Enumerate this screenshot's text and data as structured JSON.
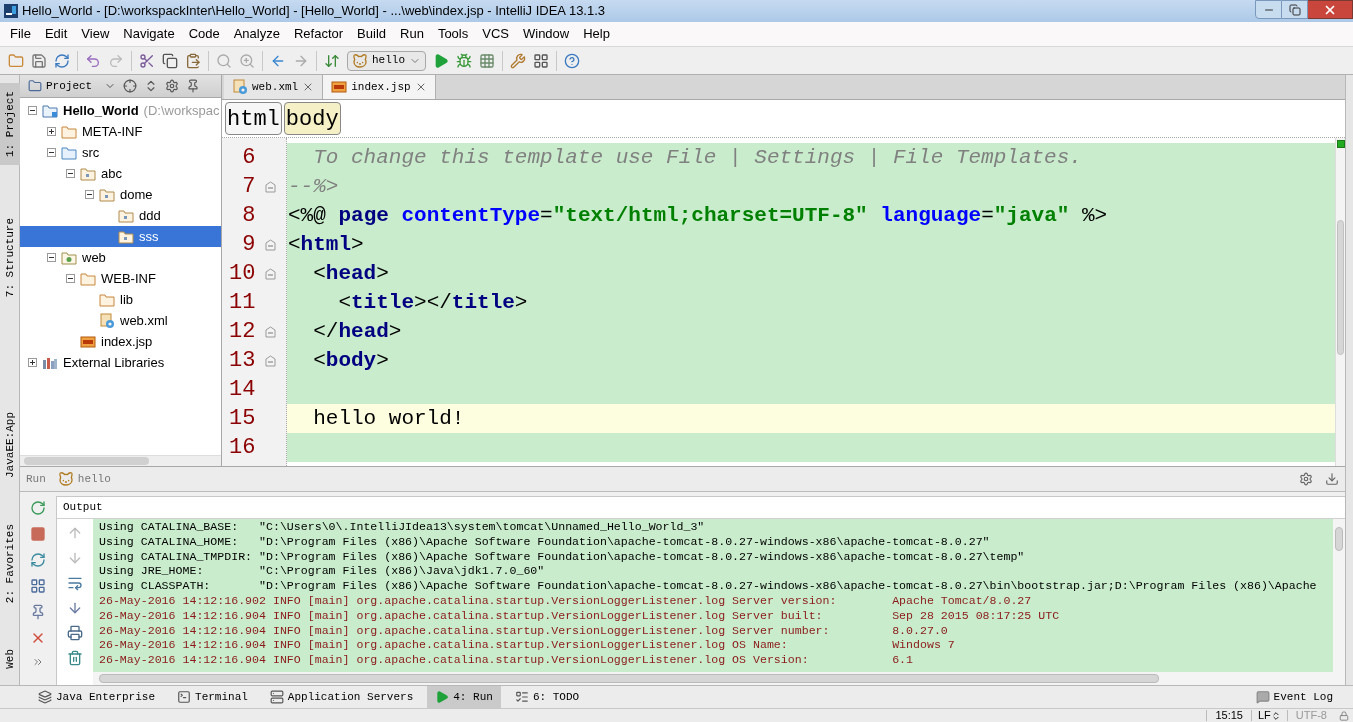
{
  "window": {
    "title": "Hello_World - [D:\\workspackInter\\Hello_World] - [Hello_World] - ...\\web\\index.jsp - IntelliJ IDEA 13.1.3"
  },
  "menu": [
    "File",
    "Edit",
    "View",
    "Navigate",
    "Code",
    "Analyze",
    "Refactor",
    "Build",
    "Run",
    "Tools",
    "VCS",
    "Window",
    "Help"
  ],
  "toolbar": {
    "run_config": "hello"
  },
  "left_stripe": {
    "top": [
      {
        "label": "1: Project",
        "selected": true
      },
      {
        "label": "7: Structure",
        "selected": false
      }
    ],
    "bottom": [
      {
        "label": "JavaEE:App",
        "selected": false
      },
      {
        "label": "2: Favorites",
        "selected": false
      },
      {
        "label": "Web",
        "selected": false
      }
    ]
  },
  "project_panel": {
    "title": "Project",
    "tree": [
      {
        "label": "Hello_World",
        "hint": "(D:\\workspac",
        "kind": "module",
        "expanded": true,
        "selected": false,
        "children": [
          {
            "label": "META-INF",
            "kind": "folder",
            "expanded": false,
            "selected": false
          },
          {
            "label": "src",
            "kind": "source",
            "expanded": true,
            "selected": false,
            "children": [
              {
                "label": "abc",
                "kind": "package",
                "expanded": true,
                "selected": false,
                "children": [
                  {
                    "label": "dome",
                    "kind": "package",
                    "expanded": true,
                    "selected": false,
                    "children": [
                      {
                        "label": "ddd",
                        "kind": "package",
                        "selected": false
                      },
                      {
                        "label": "sss",
                        "kind": "package",
                        "selected": true
                      }
                    ]
                  }
                ]
              }
            ]
          },
          {
            "label": "web",
            "kind": "webfolder",
            "expanded": true,
            "selected": false,
            "children": [
              {
                "label": "WEB-INF",
                "kind": "folder",
                "expanded": true,
                "selected": false,
                "children": [
                  {
                    "label": "lib",
                    "kind": "folder",
                    "selected": false
                  },
                  {
                    "label": "web.xml",
                    "kind": "xml",
                    "selected": false
                  }
                ]
              },
              {
                "label": "index.jsp",
                "kind": "jsp",
                "selected": false
              }
            ]
          }
        ]
      },
      {
        "label": "External Libraries",
        "kind": "library",
        "expanded": false,
        "selected": false
      }
    ]
  },
  "editor": {
    "tabs": [
      {
        "label": "web.xml",
        "kind": "xml",
        "selected": false
      },
      {
        "label": "index.jsp",
        "kind": "jsp",
        "selected": true
      }
    ],
    "breadcrumbs": [
      {
        "label": "html",
        "selected": false
      },
      {
        "label": "body",
        "selected": true
      }
    ],
    "lines": [
      {
        "number": "6",
        "fold": false,
        "current": false,
        "segments": [
          {
            "kind": "comment",
            "text": "  To change this template use File | Settings | File Templates."
          }
        ]
      },
      {
        "number": "7",
        "fold": true,
        "current": false,
        "segments": [
          {
            "kind": "comment",
            "text": "--%>"
          }
        ]
      },
      {
        "number": "8",
        "fold": false,
        "current": false,
        "segments": [
          {
            "kind": "plain",
            "text": "<%@ "
          },
          {
            "kind": "keyword",
            "text": "page "
          },
          {
            "kind": "attr",
            "text": "contentType"
          },
          {
            "kind": "plain",
            "text": "="
          },
          {
            "kind": "string",
            "text": "\"text/html;charset=UTF-8\""
          },
          {
            "kind": "attr",
            "text": " language"
          },
          {
            "kind": "plain",
            "text": "="
          },
          {
            "kind": "string",
            "text": "\"java\""
          },
          {
            "kind": "plain",
            "text": " %>"
          }
        ]
      },
      {
        "number": "9",
        "fold": true,
        "current": false,
        "segments": [
          {
            "kind": "plain",
            "text": "<"
          },
          {
            "kind": "tag",
            "text": "html"
          },
          {
            "kind": "plain",
            "text": ">"
          }
        ]
      },
      {
        "number": "10",
        "fold": true,
        "current": false,
        "segments": [
          {
            "kind": "plain",
            "text": "  <"
          },
          {
            "kind": "tag",
            "text": "head"
          },
          {
            "kind": "plain",
            "text": ">"
          }
        ]
      },
      {
        "number": "11",
        "fold": false,
        "current": false,
        "segments": [
          {
            "kind": "plain",
            "text": "    <"
          },
          {
            "kind": "tag",
            "text": "title"
          },
          {
            "kind": "plain",
            "text": "></"
          },
          {
            "kind": "tag",
            "text": "title"
          },
          {
            "kind": "plain",
            "text": ">"
          }
        ]
      },
      {
        "number": "12",
        "fold": true,
        "current": false,
        "segments": [
          {
            "kind": "plain",
            "text": "  </"
          },
          {
            "kind": "tag",
            "text": "head"
          },
          {
            "kind": "plain",
            "text": ">"
          }
        ]
      },
      {
        "number": "13",
        "fold": true,
        "current": false,
        "segments": [
          {
            "kind": "plain",
            "text": "  <"
          },
          {
            "kind": "tag",
            "text": "body"
          },
          {
            "kind": "plain",
            "text": ">"
          }
        ]
      },
      {
        "number": "14",
        "fold": false,
        "current": false
      },
      {
        "number": "15",
        "fold": false,
        "current": true,
        "segments": [
          {
            "kind": "plain",
            "text": "  hello world!"
          }
        ]
      },
      {
        "number": "16",
        "fold": false,
        "current": false
      }
    ]
  },
  "run_panel": {
    "title": "Run",
    "config": "hello",
    "output_tab": "Output",
    "console": [
      {
        "kind": "info",
        "text": "Using CATALINA_BASE:   \"C:\\Users\\0\\.IntelliJIdea13\\system\\tomcat\\Unnamed_Hello_World_3\""
      },
      {
        "kind": "info",
        "text": "Using CATALINA_HOME:   \"D:\\Program Files (x86)\\Apache Software Foundation\\apache-tomcat-8.0.27-windows-x86\\apache-tomcat-8.0.27\""
      },
      {
        "kind": "info",
        "text": "Using CATALINA_TMPDIR: \"D:\\Program Files (x86)\\Apache Software Foundation\\apache-tomcat-8.0.27-windows-x86\\apache-tomcat-8.0.27\\temp\""
      },
      {
        "kind": "info",
        "text": "Using JRE_HOME:        \"C:\\Program Files (x86)\\Java\\jdk1.7.0_60\""
      },
      {
        "kind": "info",
        "text": "Using CLASSPATH:       \"D:\\Program Files (x86)\\Apache Software Foundation\\apache-tomcat-8.0.27-windows-x86\\apache-tomcat-8.0.27\\bin\\bootstrap.jar;D:\\Program Files (x86)\\Apache"
      },
      {
        "kind": "log",
        "text": "26-May-2016 14:12:16.902 INFO [main] org.apache.catalina.startup.VersionLoggerListener.log Server version:        Apache Tomcat/8.0.27"
      },
      {
        "kind": "log",
        "text": "26-May-2016 14:12:16.904 INFO [main] org.apache.catalina.startup.VersionLoggerListener.log Server built:          Sep 28 2015 08:17:25 UTC"
      },
      {
        "kind": "log",
        "text": "26-May-2016 14:12:16.904 INFO [main] org.apache.catalina.startup.VersionLoggerListener.log Server number:         8.0.27.0"
      },
      {
        "kind": "log",
        "text": "26-May-2016 14:12:16.904 INFO [main] org.apache.catalina.startup.VersionLoggerListener.log OS Name:               Windows 7"
      },
      {
        "kind": "log",
        "text": "26-May-2016 14:12:16.904 INFO [main] org.apache.catalina.startup.VersionLoggerListener.log OS Version:            6.1"
      }
    ]
  },
  "bottom_tools": [
    {
      "label": "Java Enterprise",
      "kind": "javaee",
      "selected": false
    },
    {
      "label": "Terminal",
      "kind": "terminal",
      "selected": false
    },
    {
      "label": "Application Servers",
      "kind": "servers",
      "selected": false
    },
    {
      "label": "4: Run",
      "kind": "run",
      "selected": true
    },
    {
      "label": "6: TODO",
      "kind": "todo",
      "selected": false
    }
  ],
  "event_log": "Event Log",
  "status_bar": {
    "position": "15:15",
    "line_separator": "LF",
    "encoding": "UTF-8"
  }
}
